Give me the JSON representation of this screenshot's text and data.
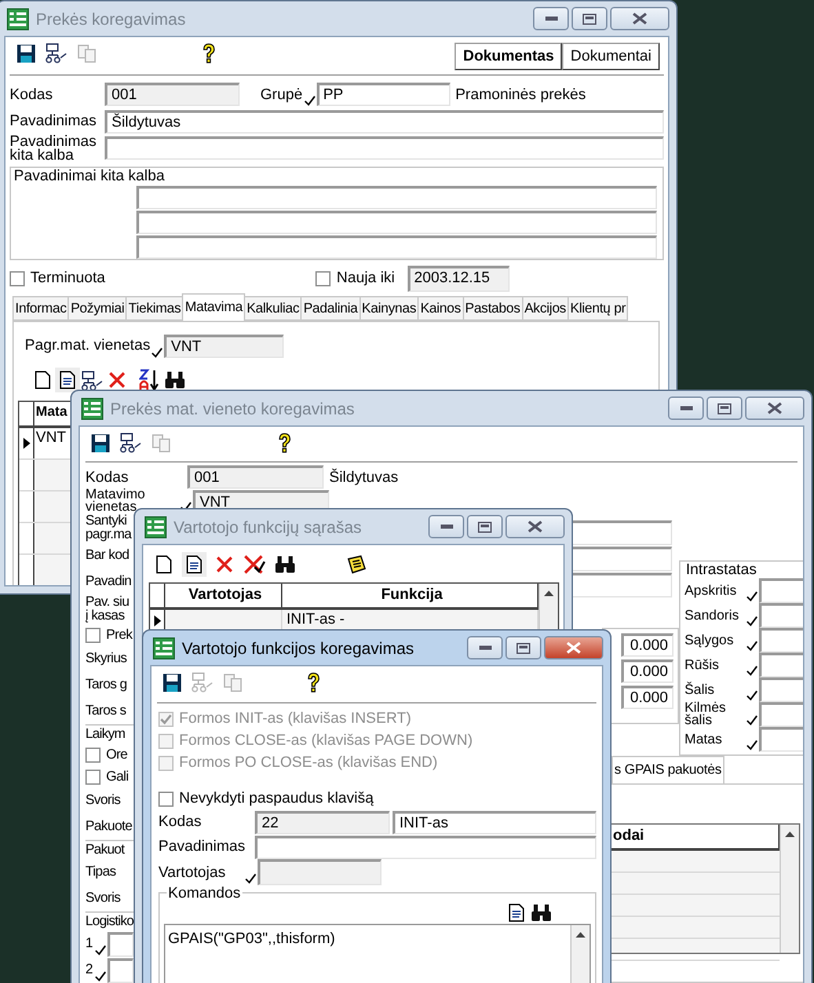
{
  "product_window": {
    "title": "Prekės koregavimas",
    "active": false,
    "toolbar_buttons": [
      {
        "label": "Dokumentas",
        "default": true
      },
      {
        "label": "Dokumentai",
        "default": false
      }
    ],
    "code": {
      "label": "Kodas",
      "value": "001"
    },
    "group": {
      "label": "Grupė",
      "value": "PP",
      "description": "Pramoninės prekės"
    },
    "name": {
      "label": "Pavadinimas",
      "value": "Šildytuvas"
    },
    "name_other_language": {
      "label": "Pavadinimas kita kalba"
    },
    "other_names_group": {
      "title": "Pavadinimai kita kalba"
    },
    "term": {
      "label": "Terminuota",
      "checked": false
    },
    "new_until": {
      "label": "Nauja iki",
      "checked": false,
      "value": "2003.12.15"
    },
    "tabs": [
      {
        "label": "Informac",
        "selected": false
      },
      {
        "label": "Požymiai",
        "selected": false
      },
      {
        "label": "Tiekimas",
        "selected": false
      },
      {
        "label": "Matavima",
        "selected": true
      },
      {
        "label": "Kalkuliac",
        "selected": false
      },
      {
        "label": "Padalinia",
        "selected": false
      },
      {
        "label": "Kainynas",
        "selected": false
      },
      {
        "label": "Kainos",
        "selected": false
      },
      {
        "label": "Pastabos",
        "selected": false
      },
      {
        "label": "Akcijos",
        "selected": false
      },
      {
        "label": "Klientų pr",
        "selected": false
      }
    ],
    "base_unit": {
      "label": "Pagr.mat. vienetas",
      "value": "VNT"
    },
    "grid": {
      "columns": [
        "Mata"
      ],
      "rows": [
        {
          "value": "VNT",
          "current": true
        }
      ]
    }
  },
  "unit_window": {
    "title": "Prekės mat. vieneto koregavimas",
    "active": false,
    "code": {
      "label": "Kodas",
      "value": "001",
      "description": "Šildytuvas"
    },
    "unit": {
      "label": "Matavimo vienetas",
      "value": "VNT"
    },
    "left_items": [
      {
        "kind": "label",
        "text": "Santyki\npagr.ma"
      },
      {
        "kind": "label",
        "text": "Bar kod"
      },
      {
        "kind": "label",
        "text": "Pavadin"
      },
      {
        "kind": "label",
        "text": "Pav. siu\nį kasas"
      },
      {
        "kind": "checkbox",
        "text": "Prek",
        "checked": false
      },
      {
        "kind": "label",
        "text": "Skyrius"
      },
      {
        "kind": "label",
        "text": "Taros g"
      },
      {
        "kind": "label",
        "text": "Taros s"
      },
      {
        "kind": "group",
        "text": "Laikym"
      },
      {
        "kind": "checkbox",
        "text": "Ore",
        "checked": false
      },
      {
        "kind": "checkbox",
        "text": "Gali",
        "checked": false
      },
      {
        "kind": "label",
        "text": "Svoris"
      },
      {
        "kind": "label",
        "text": "Pakuote"
      },
      {
        "kind": "group",
        "text": "Pakuot"
      },
      {
        "kind": "label",
        "text": "Tipas"
      },
      {
        "kind": "label",
        "text": "Svoris"
      },
      {
        "kind": "group",
        "text": "Logistiko"
      },
      {
        "kind": "lookup",
        "text": "1"
      },
      {
        "kind": "lookup",
        "text": "2"
      }
    ],
    "values": [
      "0.000",
      "0.000",
      "0.000"
    ],
    "intrastat": {
      "title": "Intrastatas",
      "fields": [
        {
          "label": "Apskritis"
        },
        {
          "label": "Sandoris"
        },
        {
          "label": "Sąlygos"
        },
        {
          "label": "Rūšis"
        },
        {
          "label": "Šalis"
        },
        {
          "label": "Kilmės\nšalis"
        },
        {
          "label": "Matas"
        }
      ]
    },
    "tabs": [
      {
        "label": "s GPAIS pakuotės",
        "selected": true
      }
    ],
    "grid": {
      "columns": [
        "odai"
      ]
    }
  },
  "function_list_window": {
    "title": "Vartotojo funkcijų sąrašas",
    "active": false,
    "grid": {
      "columns": [
        "Vartotojas",
        "Funkcija"
      ],
      "rows": [
        {
          "function": "INIT-as -",
          "current": true
        }
      ]
    }
  },
  "function_edit_window": {
    "title": "Vartotojo funkcijos koregavimas",
    "active": true,
    "triggers": [
      {
        "label": "Formos INIT-as (klavišas INSERT)",
        "checked": true,
        "disabled": true
      },
      {
        "label": "Formos CLOSE-as (klavišas PAGE DOWN)",
        "checked": false,
        "disabled": true
      },
      {
        "label": "Formos PO CLOSE-as (klavišas END)",
        "checked": false,
        "disabled": true
      }
    ],
    "skip_key": {
      "label": "Nevykdyti paspaudus klavišą",
      "checked": false
    },
    "code": {
      "label": "Kodas",
      "value": "22",
      "function": "INIT-as"
    },
    "name": {
      "label": "Pavadinimas"
    },
    "user": {
      "label": "Vartotojas"
    },
    "commands": {
      "title": "Komandos",
      "value": "GPAIS(\"GP03\",,thisform)"
    }
  }
}
